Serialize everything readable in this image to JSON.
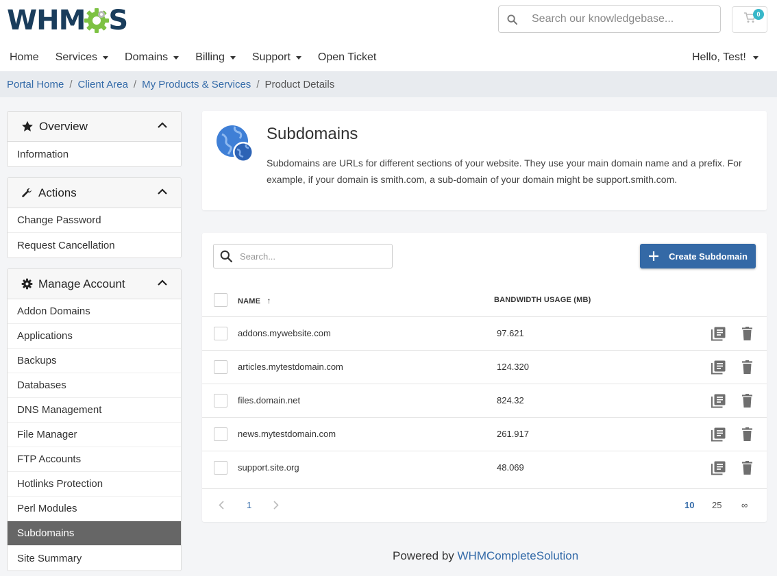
{
  "header": {
    "logo_left": "WHM",
    "logo_right": "S",
    "search_placeholder": "Search our knowledgebase...",
    "cart_count": "0"
  },
  "nav": {
    "items": [
      {
        "label": "Home",
        "dropdown": false
      },
      {
        "label": "Services",
        "dropdown": true
      },
      {
        "label": "Domains",
        "dropdown": true
      },
      {
        "label": "Billing",
        "dropdown": true
      },
      {
        "label": "Support",
        "dropdown": true
      },
      {
        "label": "Open Ticket",
        "dropdown": false
      }
    ],
    "user_label": "Hello, Test!"
  },
  "breadcrumb": {
    "items": [
      "Portal Home",
      "Client Area",
      "My Products & Services"
    ],
    "current": "Product Details"
  },
  "sidebar": {
    "overview": {
      "title": "Overview",
      "items": [
        "Information"
      ]
    },
    "actions": {
      "title": "Actions",
      "items": [
        "Change Password",
        "Request Cancellation"
      ]
    },
    "manage": {
      "title": "Manage Account",
      "items": [
        "Addon Domains",
        "Applications",
        "Backups",
        "Databases",
        "DNS Management",
        "File Manager",
        "FTP Accounts",
        "Hotlinks Protection",
        "Perl Modules",
        "Subdomains",
        "Site Summary"
      ],
      "active": "Subdomains"
    }
  },
  "intro": {
    "title": "Subdomains",
    "description": "Subdomains are URLs for different sections of your website. They use your main domain name and a prefix. For example, if your domain is smith.com, a sub-domain of your domain might be support.smith.com."
  },
  "table": {
    "search_placeholder": "Search...",
    "create_label": "Create Subdomain",
    "col_name": "NAME",
    "col_bandwidth": "BANDWIDTH USAGE (MB)",
    "sort_indicator": "↑",
    "rows": [
      {
        "name": "addons.mywebsite.com",
        "bandwidth": "97.621"
      },
      {
        "name": "articles.mytestdomain.com",
        "bandwidth": "124.320"
      },
      {
        "name": "files.domain.net",
        "bandwidth": "824.32"
      },
      {
        "name": "news.mytestdomain.com",
        "bandwidth": "261.917"
      },
      {
        "name": "support.site.org",
        "bandwidth": "48.069"
      }
    ],
    "pagination": {
      "current_page": "1",
      "page_sizes": [
        "10",
        "25",
        "∞"
      ],
      "selected_size": "10"
    }
  },
  "footer": {
    "prefix": "Powered by ",
    "link": "WHMCompleteSolution"
  },
  "colors": {
    "accent": "#3469a6",
    "link": "#336aa8",
    "active_item": "#666666",
    "logo_green": "#7dc243",
    "logo_navy": "#1a3d5c"
  }
}
